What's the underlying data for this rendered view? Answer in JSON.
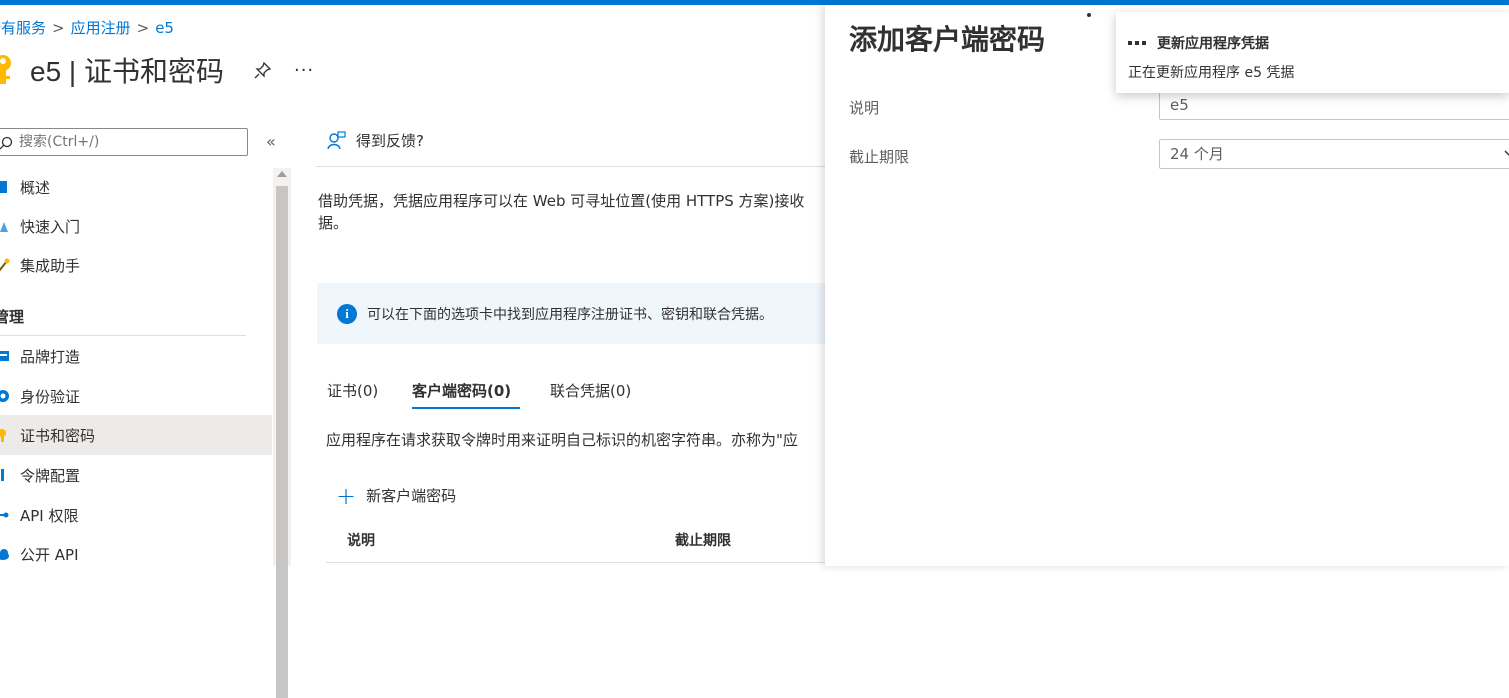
{
  "breadcrumb": {
    "item1": "所有服务",
    "item2": "应用注册",
    "item3": "e5"
  },
  "header": {
    "title": "e5 | 证书和密码",
    "more": "···"
  },
  "sidebar": {
    "search_placeholder": "搜索(Ctrl+/)",
    "collapse": "«",
    "items": [
      {
        "label": "概述",
        "icon": "overview-icon"
      },
      {
        "label": "快速入门",
        "icon": "quickstart-icon"
      },
      {
        "label": "集成助手",
        "icon": "integration-icon"
      }
    ],
    "section": "管理",
    "manage_items": [
      {
        "label": "品牌打造",
        "icon": "branding-icon"
      },
      {
        "label": "身份验证",
        "icon": "authentication-icon"
      },
      {
        "label": "证书和密码",
        "icon": "key-icon",
        "selected": true
      },
      {
        "label": "令牌配置",
        "icon": "token-icon"
      },
      {
        "label": "API 权限",
        "icon": "api-permissions-icon"
      },
      {
        "label": "公开 API",
        "icon": "expose-api-icon"
      }
    ]
  },
  "main": {
    "feedback": "得到反馈?",
    "description": "借助凭据，凭据应用程序可以在 Web 可寻址位置(使用 HTTPS 方案)接收据。",
    "info": "可以在下面的选项卡中找到应用程序注册证书、密钥和联合凭据。",
    "tabs": [
      {
        "label": "证书(0)"
      },
      {
        "label": "客户端密码(0)",
        "active": true
      },
      {
        "label": "联合凭据(0)"
      }
    ],
    "tab_description": "应用程序在请求获取令牌时用来证明自己标识的机密字符串。亦称为\"应",
    "new_secret": "新客户端密码",
    "columns": [
      "说明",
      "截止期限"
    ]
  },
  "panel": {
    "title": "添加客户端密码",
    "description_label": "说明",
    "description_value": "e5",
    "expiry_label": "截止期限",
    "expiry_value": "24 个月"
  },
  "toast": {
    "title": "更新应用程序凭据",
    "message": "正在更新应用程序 e5 凭据"
  },
  "colors": {
    "accent": "#0078d4",
    "selected_bg": "#edebe9",
    "info_bg": "#eff6fc"
  }
}
